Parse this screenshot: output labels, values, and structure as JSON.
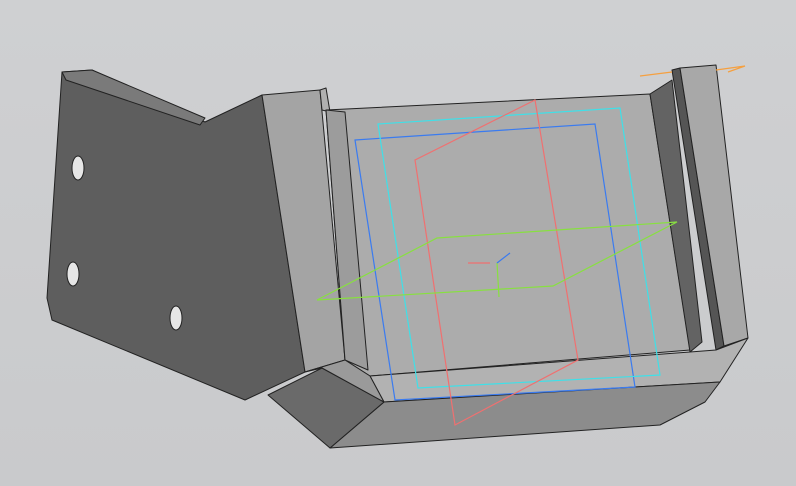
{
  "viewport": {
    "background": "#cdcecf",
    "model_colors": {
      "dark_face": "#5c5c5c",
      "mid_face": "#8a8a8a",
      "light_face": "#a9a9a9",
      "edge": "#222222"
    },
    "sketch_colors": {
      "plane_cyan": "#3fe0e8",
      "plane_blue": "#3a7bf0",
      "plane_red": "#f07070",
      "plane_green": "#88e040",
      "axis_orange": "#f5a040"
    }
  }
}
